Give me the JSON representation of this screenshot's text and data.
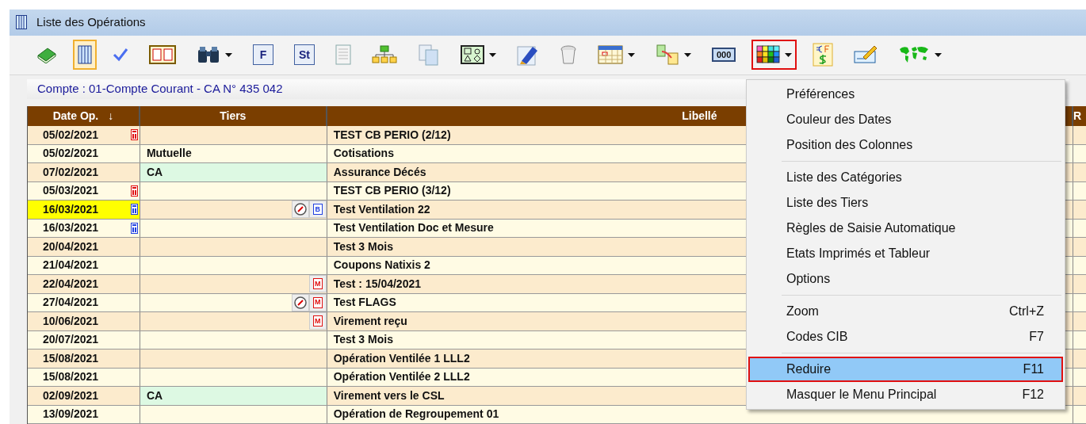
{
  "window": {
    "title": "Liste des Opérations"
  },
  "toolbar": [
    {
      "kind": "book",
      "selected": false,
      "dropdown": false,
      "marked": false
    },
    {
      "kind": "columns",
      "selected": true,
      "dropdown": false,
      "marked": false
    },
    {
      "kind": "check",
      "selected": false,
      "dropdown": false,
      "marked": false
    },
    {
      "kind": "counter",
      "selected": false,
      "dropdown": false,
      "marked": false
    },
    {
      "kind": "binoculars",
      "selected": false,
      "dropdown": true,
      "marked": false
    },
    {
      "kind": "letter",
      "text": "F",
      "selected": false,
      "dropdown": false,
      "marked": false
    },
    {
      "kind": "letter",
      "text": "St",
      "selected": false,
      "dropdown": false,
      "marked": false
    },
    {
      "kind": "document",
      "selected": false,
      "dropdown": false,
      "marked": false
    },
    {
      "kind": "hierarchy",
      "selected": false,
      "dropdown": false,
      "marked": false
    },
    {
      "kind": "copy",
      "selected": false,
      "dropdown": false,
      "marked": false
    },
    {
      "kind": "shapes",
      "selected": false,
      "dropdown": true,
      "marked": false
    },
    {
      "kind": "pen",
      "selected": false,
      "dropdown": false,
      "marked": false
    },
    {
      "kind": "trash",
      "selected": false,
      "dropdown": false,
      "marked": false
    },
    {
      "kind": "calendar",
      "selected": false,
      "dropdown": true,
      "marked": false
    },
    {
      "kind": "transfer",
      "selected": false,
      "dropdown": true,
      "marked": false
    },
    {
      "kind": "digits",
      "text": "000",
      "selected": false,
      "dropdown": false,
      "marked": false
    },
    {
      "kind": "palette",
      "selected": false,
      "dropdown": true,
      "marked": true
    },
    {
      "kind": "currency",
      "selected": false,
      "dropdown": false,
      "marked": false
    },
    {
      "kind": "cheque",
      "selected": false,
      "dropdown": false,
      "marked": false
    },
    {
      "kind": "map",
      "selected": false,
      "dropdown": true,
      "marked": false
    }
  ],
  "account": "Compte : 01-Compte Courant - CA N° 435 042",
  "table": {
    "columns": [
      {
        "label": "Date Op.",
        "sort_mark": "↓"
      },
      {
        "label": "Tiers"
      },
      {
        "label": "Libellé"
      },
      {
        "label": "R"
      }
    ],
    "rows": [
      {
        "date": "05/02/2021",
        "date_highlighted": false,
        "date_flag": {
          "color": "#e01010"
        },
        "tiers": "",
        "tiers_highlighted": false,
        "marks": [],
        "libelle": "TEST CB PERIO (2/12)"
      },
      {
        "date": "05/02/2021",
        "date_highlighted": false,
        "tiers": "Mutuelle",
        "tiers_highlighted": false,
        "marks": [],
        "libelle": "Cotisations"
      },
      {
        "date": "07/02/2021",
        "date_highlighted": false,
        "tiers": "CA",
        "tiers_highlighted": true,
        "marks": [],
        "libelle": "Assurance Décés"
      },
      {
        "date": "05/03/2021",
        "date_highlighted": false,
        "date_flag": {
          "color": "#e01010"
        },
        "tiers": "",
        "tiers_highlighted": false,
        "marks": [],
        "libelle": "TEST CB PERIO (3/12)"
      },
      {
        "date": "16/03/2021",
        "date_highlighted": true,
        "date_flag": {
          "color": "#2040e0"
        },
        "tiers": "",
        "tiers_highlighted": false,
        "marks": [
          {
            "kind": "gauge"
          },
          {
            "kind": "letter",
            "text": "B",
            "color": "#2040e0"
          }
        ],
        "libelle": "Test Ventilation 22"
      },
      {
        "date": "16/03/2021",
        "date_highlighted": false,
        "date_flag": {
          "color": "#2040e0"
        },
        "tiers": "",
        "tiers_highlighted": false,
        "marks": [],
        "libelle": "Test Ventilation Doc et Mesure"
      },
      {
        "date": "20/04/2021",
        "date_highlighted": false,
        "tiers": "",
        "tiers_highlighted": false,
        "marks": [],
        "libelle": "Test 3 Mois"
      },
      {
        "date": "21/04/2021",
        "date_highlighted": false,
        "tiers": "",
        "tiers_highlighted": false,
        "marks": [],
        "libelle": "Coupons Natixis 2"
      },
      {
        "date": "22/04/2021",
        "date_highlighted": false,
        "tiers": "",
        "tiers_highlighted": false,
        "marks": [
          {
            "kind": "letter",
            "text": "M",
            "color": "#e01010"
          }
        ],
        "libelle": "Test : 15/04/2021"
      },
      {
        "date": "27/04/2021",
        "date_highlighted": false,
        "tiers": "",
        "tiers_highlighted": false,
        "marks": [
          {
            "kind": "gauge"
          },
          {
            "kind": "letter",
            "text": "M",
            "color": "#e01010"
          }
        ],
        "libelle": "Test FLAGS"
      },
      {
        "date": "10/06/2021",
        "date_highlighted": false,
        "tiers": "",
        "tiers_highlighted": false,
        "marks": [
          {
            "kind": "letter",
            "text": "M",
            "color": "#e01010"
          }
        ],
        "libelle": "Virement reçu"
      },
      {
        "date": "20/07/2021",
        "date_highlighted": false,
        "tiers": "",
        "tiers_highlighted": false,
        "marks": [],
        "libelle": "Test 3 Mois"
      },
      {
        "date": "15/08/2021",
        "date_highlighted": false,
        "tiers": "",
        "tiers_highlighted": false,
        "marks": [],
        "libelle": "Opération Ventilée 1 LLL2"
      },
      {
        "date": "15/08/2021",
        "date_highlighted": false,
        "tiers": "",
        "tiers_highlighted": false,
        "marks": [],
        "libelle": "Opération Ventilée 2 LLL2"
      },
      {
        "date": "02/09/2021",
        "date_highlighted": false,
        "tiers": "CA",
        "tiers_highlighted": true,
        "marks": [],
        "libelle": "Virement vers le CSL"
      },
      {
        "date": "13/09/2021",
        "date_highlighted": false,
        "tiers": "",
        "tiers_highlighted": false,
        "marks": [],
        "libelle": "Opération de Regroupement 01"
      }
    ]
  },
  "menu": {
    "items": [
      {
        "kind": "item",
        "label": "Préférences",
        "selected": false,
        "marked": false
      },
      {
        "kind": "item",
        "label": "Couleur des Dates",
        "selected": false,
        "marked": false
      },
      {
        "kind": "item",
        "label": "Position des Colonnes",
        "selected": false,
        "marked": false
      },
      {
        "kind": "separator"
      },
      {
        "kind": "item",
        "label": "Liste des Catégories",
        "selected": false,
        "marked": false
      },
      {
        "kind": "item",
        "label": "Liste des Tiers",
        "selected": false,
        "marked": false
      },
      {
        "kind": "item",
        "label": "Règles de Saisie Automatique",
        "selected": false,
        "marked": false
      },
      {
        "kind": "item",
        "label": "Etats Imprimés et Tableur",
        "selected": false,
        "marked": false
      },
      {
        "kind": "item",
        "label": "Options",
        "selected": false,
        "marked": false
      },
      {
        "kind": "separator"
      },
      {
        "kind": "item",
        "label": "Zoom",
        "shortcut": "Ctrl+Z",
        "selected": false,
        "marked": false
      },
      {
        "kind": "item",
        "label": "Codes CIB",
        "shortcut": "F7",
        "selected": false,
        "marked": false
      },
      {
        "kind": "separator"
      },
      {
        "kind": "item",
        "label": "Reduire",
        "shortcut": "F11",
        "selected": true,
        "marked": true
      },
      {
        "kind": "item",
        "label": "Masquer le Menu Principal",
        "shortcut": "F12",
        "selected": false,
        "marked": false
      }
    ]
  }
}
